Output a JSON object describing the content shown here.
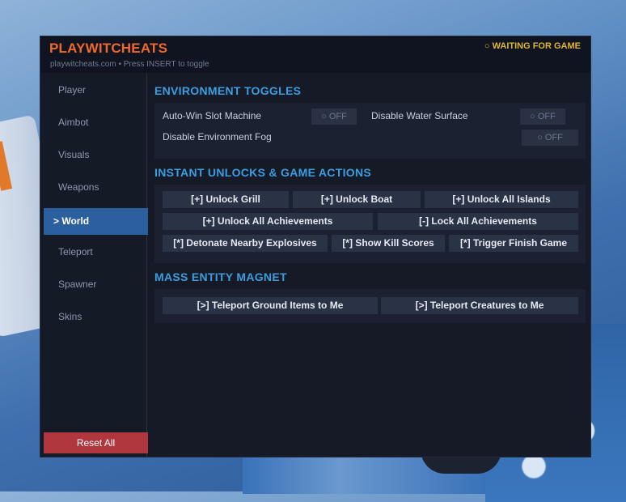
{
  "header": {
    "brand": "PLAYWITCHEATS",
    "hint": "playwitcheats.com • Press INSERT to toggle",
    "status": "○ WAITING FOR GAME"
  },
  "sidebar": {
    "items": [
      {
        "label": "Player"
      },
      {
        "label": "Aimbot"
      },
      {
        "label": "Visuals"
      },
      {
        "label": "Weapons"
      },
      {
        "label": "> World",
        "active": true
      },
      {
        "label": "Teleport"
      },
      {
        "label": "Spawner"
      },
      {
        "label": "Skins"
      }
    ],
    "reset_label": "Reset All"
  },
  "sections": {
    "environment": {
      "title": "ENVIRONMENT TOGGLES",
      "toggles": [
        {
          "label": "Auto-Win Slot Machine",
          "state": "○ OFF"
        },
        {
          "label": "Disable Water Surface",
          "state": "○ OFF"
        },
        {
          "label": "Disable Environment Fog",
          "state": "○ OFF"
        }
      ]
    },
    "unlocks": {
      "title": "INSTANT UNLOCKS & GAME ACTIONS",
      "buttons": [
        "[+] Unlock Grill",
        "[+] Unlock Boat",
        "[+] Unlock All Islands",
        "[+] Unlock All Achievements",
        "[-] Lock All Achievements",
        "[*] Detonate Nearby Explosives",
        "[*] Show Kill Scores",
        "[*] Trigger Finish Game"
      ]
    },
    "magnet": {
      "title": "MASS ENTITY MAGNET",
      "buttons": [
        "[>] Teleport Ground Items to Me",
        "[>] Teleport Creatures to Me"
      ]
    }
  },
  "colors": {
    "accent": "#3a9ee0",
    "brand": "#ef6a2a",
    "status": "#e0b531",
    "active_nav": "#2b5f9d",
    "danger": "#b1373f"
  }
}
